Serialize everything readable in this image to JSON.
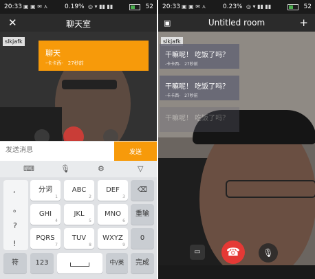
{
  "left": {
    "status": {
      "time": "20:33",
      "battery_pct": "0.19%",
      "battery": "52"
    },
    "header": {
      "title": "聊天室",
      "close": "✕"
    },
    "video_tag": "slkjafk",
    "bubble": {
      "message": "聊天",
      "sender": "卡卡西",
      "time": "27秒前"
    },
    "input": {
      "placeholder": "发送消息",
      "send": "发送"
    },
    "keyboard": {
      "punct": [
        ",",
        "。",
        "?",
        "!"
      ],
      "keys": [
        {
          "main": "分词",
          "sub": "1"
        },
        {
          "main": "ABC",
          "sub": "2"
        },
        {
          "main": "DEF",
          "sub": "3"
        },
        {
          "main": "GHI",
          "sub": "4"
        },
        {
          "main": "JKL",
          "sub": "5"
        },
        {
          "main": "MNO",
          "sub": "6"
        },
        {
          "main": "PQRS",
          "sub": "7"
        },
        {
          "main": "TUV",
          "sub": "8"
        },
        {
          "main": "WXYZ",
          "sub": "9"
        }
      ],
      "right_col": [
        "⌫",
        "重输",
        "0"
      ],
      "bottom": {
        "symbol": "符",
        "num": "123",
        "lang": "中/英",
        "done": "完成"
      }
    }
  },
  "right": {
    "status": {
      "time": "20:33",
      "battery_pct": "0.23%",
      "battery": "52"
    },
    "header": {
      "title": "Untitled room",
      "add": "+"
    },
    "video_tag": "slkjafk",
    "messages": [
      {
        "text": "干嘛呢！ 吃饭了吗？",
        "sender": "卡卡西",
        "time": "27秒前"
      },
      {
        "text": "干嘛呢！ 吃饭了吗？",
        "sender": "卡卡西",
        "time": "27秒前"
      },
      {
        "text": "干嘛呢！ 吃饭了吗？",
        "sender": "",
        "time": ""
      }
    ]
  },
  "colors": {
    "accent": "#f79a0a",
    "hangup": "#e53935"
  }
}
